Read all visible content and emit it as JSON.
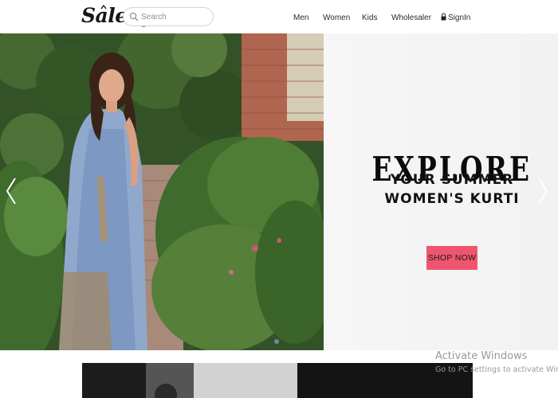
{
  "header": {
    "logo": "Saleup",
    "search": {
      "placeholder": "Search",
      "value": ""
    },
    "nav": {
      "men": "Men",
      "women": "Women",
      "kids": "Kids",
      "wholesaler": "Wholesaler",
      "signin": "SignIn"
    }
  },
  "hero": {
    "headline": "EXPLORE",
    "subline_1": "YOUR SUMMER",
    "subline_2": "WOMEN'S KURTI",
    "cta": "SHOP NOW",
    "cta_color": "#f0556f",
    "slide_count_visible": 1
  },
  "watermark": {
    "title": "Activate Windows",
    "subtitle": "Go to PC settings to activate Windows."
  },
  "icons": {
    "search": "search-icon",
    "lock": "lock-icon",
    "prev": "chevron-left-icon",
    "next": "chevron-right-icon"
  }
}
